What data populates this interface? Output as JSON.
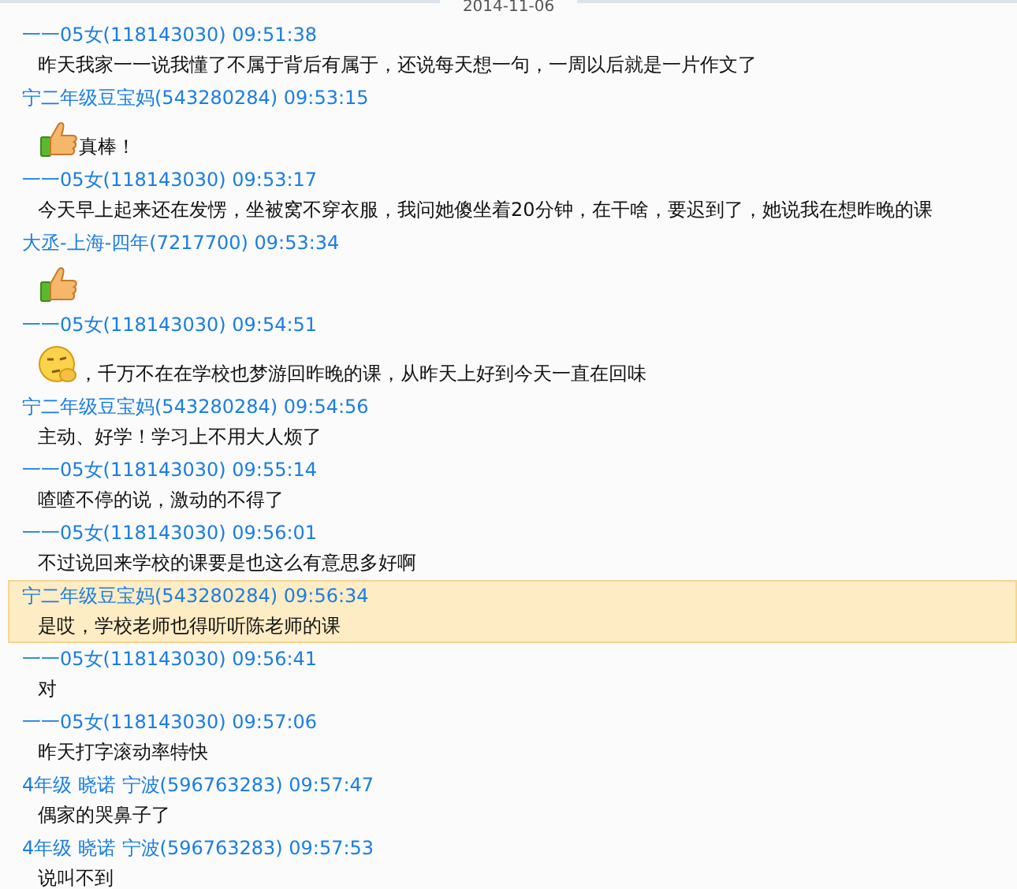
{
  "date_divider": "2014-11-06",
  "messages": [
    {
      "sender": "一一05女(118143030) 09:51:38",
      "selected": false,
      "parts": [
        {
          "kind": "text",
          "text": "昨天我家一一说我懂了不属于背后有属于，还说每天想一句，一周以后就是一片作文了"
        }
      ]
    },
    {
      "sender": "宁二年级豆宝妈(543280284) 09:53:15",
      "selected": false,
      "parts": [
        {
          "kind": "thumb"
        },
        {
          "kind": "text",
          "text": "真棒！"
        }
      ]
    },
    {
      "sender": "一一05女(118143030) 09:53:17",
      "selected": false,
      "parts": [
        {
          "kind": "text",
          "text": "今天早上起来还在发愣，坐被窝不穿衣服，我问她傻坐着20分钟，在干啥，要迟到了，她说我在想昨晚的课"
        }
      ]
    },
    {
      "sender": "大丞-上海-四年(7217700) 09:53:34",
      "selected": false,
      "parts": [
        {
          "kind": "thumb"
        }
      ]
    },
    {
      "sender": "一一05女(118143030) 09:54:51",
      "selected": false,
      "parts": [
        {
          "kind": "face"
        },
        {
          "kind": "text",
          "text": "，千万不在在学校也梦游回昨晚的课，从昨天上好到今天一直在回味"
        }
      ]
    },
    {
      "sender": "宁二年级豆宝妈(543280284) 09:54:56",
      "selected": false,
      "parts": [
        {
          "kind": "text",
          "text": "主动、好学！学习上不用大人烦了"
        }
      ]
    },
    {
      "sender": "一一05女(118143030) 09:55:14",
      "selected": false,
      "parts": [
        {
          "kind": "text",
          "text": "喳喳不停的说，激动的不得了"
        }
      ]
    },
    {
      "sender": "一一05女(118143030) 09:56:01",
      "selected": false,
      "parts": [
        {
          "kind": "text",
          "text": "不过说回来学校的课要是也这么有意思多好啊"
        }
      ]
    },
    {
      "sender": "宁二年级豆宝妈(543280284) 09:56:34",
      "selected": true,
      "parts": [
        {
          "kind": "text",
          "text": "是哎，学校老师也得听听陈老师的课"
        }
      ]
    },
    {
      "sender": "一一05女(118143030) 09:56:41",
      "selected": false,
      "parts": [
        {
          "kind": "text",
          "text": "对"
        }
      ]
    },
    {
      "sender": "一一05女(118143030) 09:57:06",
      "selected": false,
      "parts": [
        {
          "kind": "text",
          "text": "昨天打字滚动率特快"
        }
      ]
    },
    {
      "sender": "4年级 晓诺 宁波(596763283) 09:57:47",
      "selected": false,
      "parts": [
        {
          "kind": "text",
          "text": "偶家的哭鼻子了"
        }
      ]
    },
    {
      "sender": "4年级 晓诺 宁波(596763283) 09:57:53",
      "selected": false,
      "parts": [
        {
          "kind": "text",
          "text": "说叫不到"
        }
      ]
    }
  ]
}
